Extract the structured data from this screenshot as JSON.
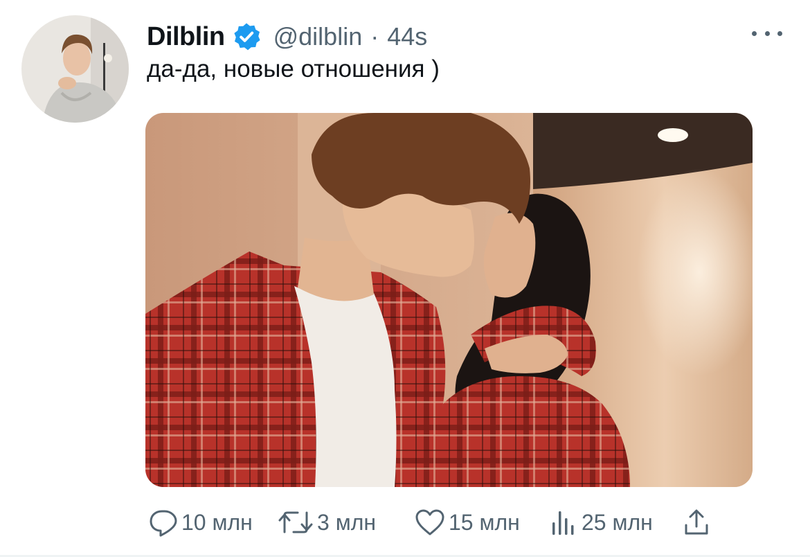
{
  "tweet": {
    "display_name": "Dilblin",
    "verified_icon": "verified-badge-icon",
    "handle": "@dilblin",
    "separator": "·",
    "time": "44s",
    "text": "да-да, новые отношения )"
  },
  "actions": {
    "reply": {
      "icon": "reply-icon",
      "count": "10 млн"
    },
    "retweet": {
      "icon": "retweet-icon",
      "count": "3 млн"
    },
    "like": {
      "icon": "heart-icon",
      "count": "15 млн"
    },
    "views": {
      "icon": "views-bar-chart-icon",
      "count": "25 млн"
    },
    "share": {
      "icon": "share-icon"
    }
  },
  "colors": {
    "text_primary": "#0f1419",
    "text_secondary": "#536471",
    "verified_blue": "#1d9bf0",
    "divider": "#eff3f4"
  }
}
